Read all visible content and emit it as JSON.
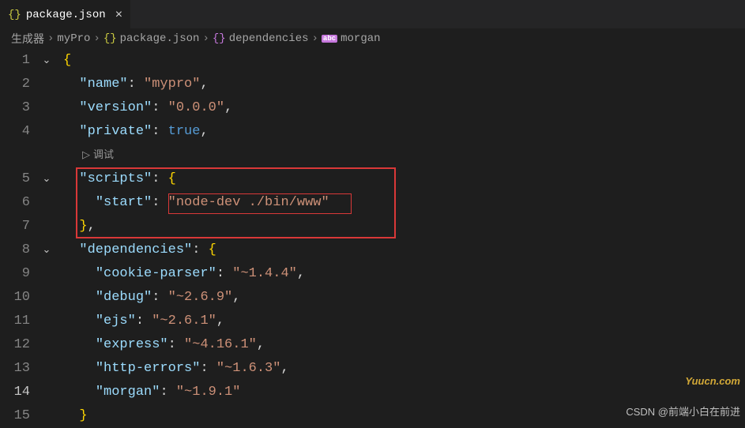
{
  "tab": {
    "icon": "{}",
    "label": "package.json"
  },
  "breadcrumbs": {
    "seg1": "生成器",
    "seg2": "myPro",
    "seg3": "package.json",
    "seg4": "dependencies",
    "seg5": "morgan"
  },
  "codelens": {
    "debug": "调试"
  },
  "lines": {
    "l1": "1",
    "l2": "2",
    "l3": "3",
    "l4": "4",
    "l5": "5",
    "l6": "6",
    "l7": "7",
    "l8": "8",
    "l9": "9",
    "l10": "10",
    "l11": "11",
    "l12": "12",
    "l13": "13",
    "l14": "14",
    "l15": "15"
  },
  "json": {
    "name_key": "\"name\"",
    "name_val": "\"mypro\"",
    "version_key": "\"version\"",
    "version_val": "\"0.0.0\"",
    "private_key": "\"private\"",
    "private_val": "true",
    "scripts_key": "\"scripts\"",
    "start_key": "\"start\"",
    "start_val": "\"node-dev ./bin/www\"",
    "deps_key": "\"dependencies\"",
    "cookie_key": "\"cookie-parser\"",
    "cookie_val": "\"~1.4.4\"",
    "debug_key": "\"debug\"",
    "debug_val": "\"~2.6.9\"",
    "ejs_key": "\"ejs\"",
    "ejs_val": "\"~2.6.1\"",
    "express_key": "\"express\"",
    "express_val": "\"~4.16.1\"",
    "httperr_key": "\"http-errors\"",
    "httperr_val": "\"~1.6.3\"",
    "morgan_key": "\"morgan\"",
    "morgan_val": "\"~1.9.1\""
  },
  "watermarks": {
    "w1": "Yuucn.com",
    "w2": "CSDN @前端小白在前进"
  }
}
